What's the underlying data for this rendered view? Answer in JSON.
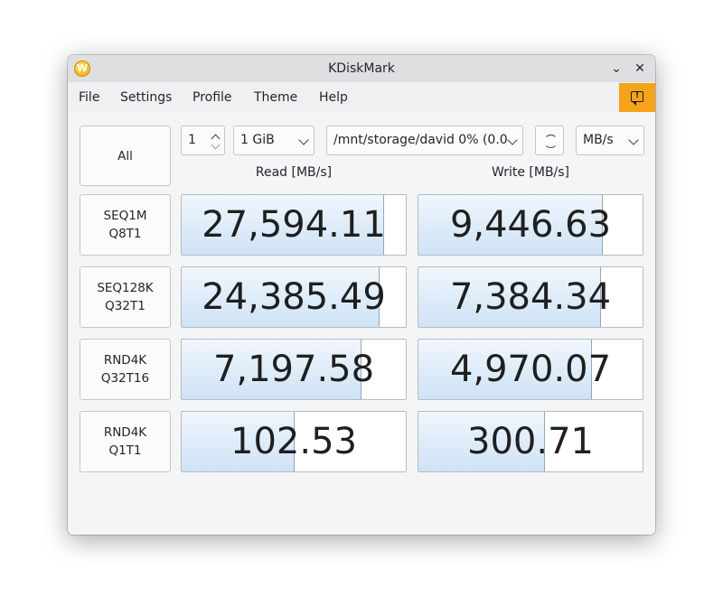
{
  "window": {
    "title": "KDiskMark",
    "app_icon": "kdiskmark-logo-icon",
    "controls": [
      "minimize-chevron-icon",
      "close-icon"
    ]
  },
  "menu": {
    "file": "File",
    "settings": "Settings",
    "profile": "Profile",
    "theme": "Theme",
    "help": "Help",
    "feedback_icon": "feedback-icon",
    "feedback_color": "#f6a21a"
  },
  "toolbar": {
    "all_label": "All",
    "loops_value": "1",
    "size_value": "1 GiB",
    "target_value": "/mnt/storage/david 0% (0.0",
    "refresh_icon": "refresh-icon",
    "unit_value": "MB/s"
  },
  "columns": {
    "read": "Read [MB/s]",
    "write": "Write [MB/s]"
  },
  "tests": [
    {
      "label": "SEQ1M\nQ8T1",
      "read": "27,594.11",
      "read_level": 0.9,
      "write": "9,446.63",
      "write_level": 0.82
    },
    {
      "label": "SEQ128K\nQ32T1",
      "read": "24,385.49",
      "read_level": 0.88,
      "write": "7,384.34",
      "write_level": 0.81
    },
    {
      "label": "RND4K\nQ32T16",
      "read": "7,197.58",
      "read_level": 0.8,
      "write": "4,970.07",
      "write_level": 0.77
    },
    {
      "label": "RND4K\nQ1T1",
      "read": "102.53",
      "read_level": 0.5,
      "write": "300.71",
      "write_level": 0.56
    }
  ],
  "colors": {
    "bar_fill_top": "#f0f6fc",
    "bar_fill_bottom": "#cfe3f6",
    "bar_edge": "#8da9c4"
  },
  "status_text": ""
}
